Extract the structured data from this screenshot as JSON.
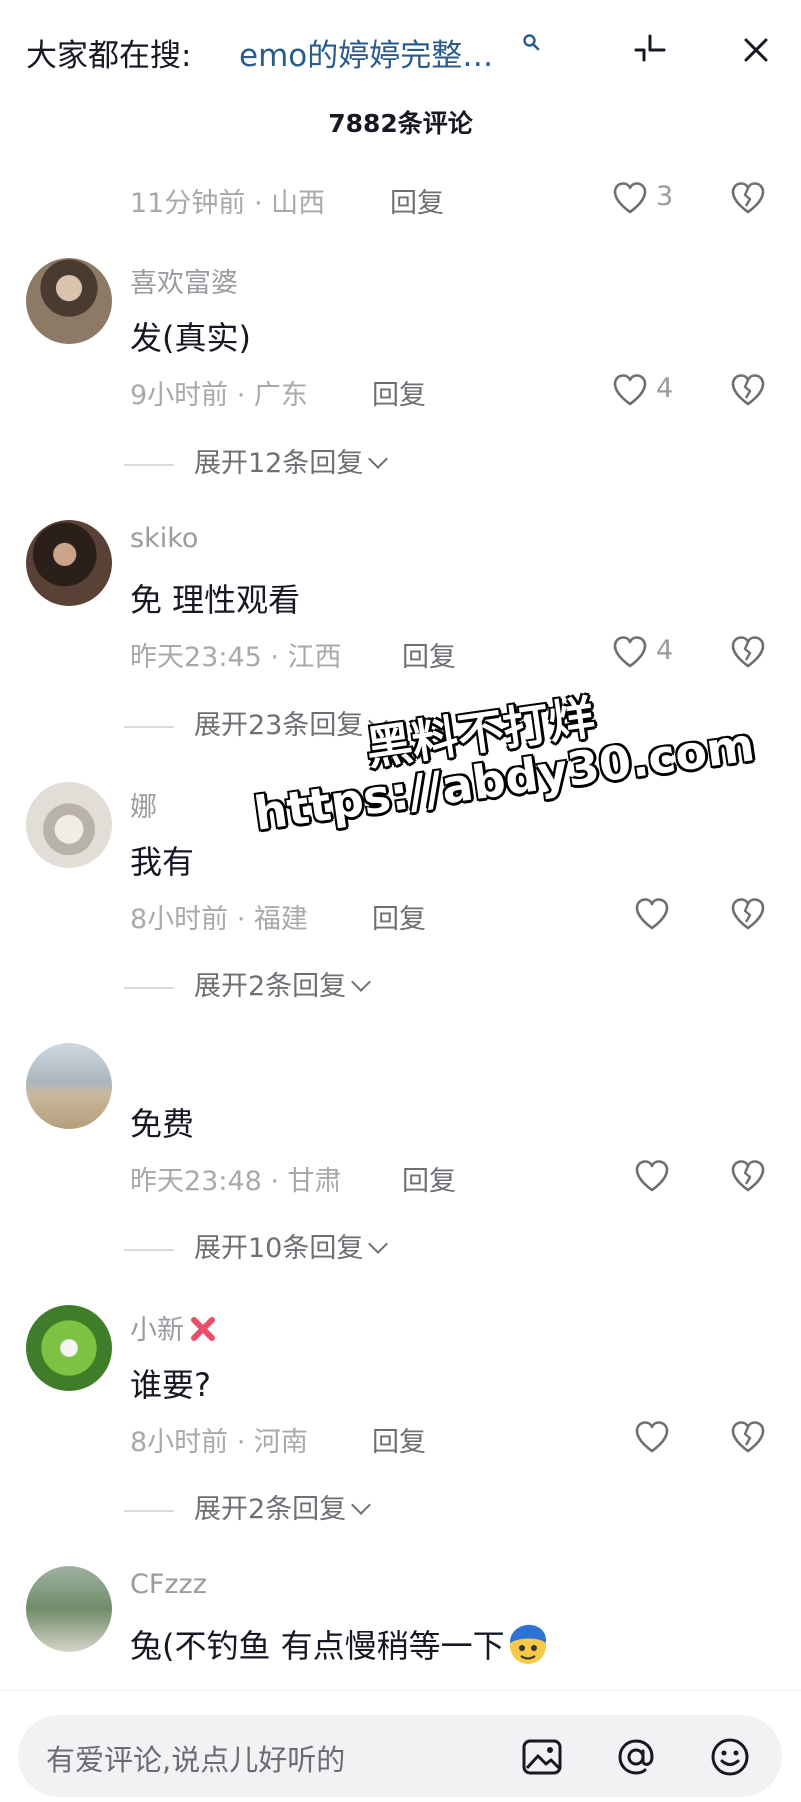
{
  "header": {
    "search_prefix": "大家都在搜:",
    "search_query": "emo的婷婷完整…",
    "search_icon": "search-icon",
    "collapse_icon": "collapse-icon",
    "close_icon": "close-icon",
    "comment_count": "7882条评论"
  },
  "comments": [
    {
      "meta": "11分钟前 · 山西",
      "reply": "回复",
      "likes": "3"
    },
    {
      "username": "喜欢富婆",
      "text": "发(真实)",
      "meta": "9小时前 · 广东",
      "reply": "回复",
      "likes": "4",
      "expand": "展开12条回复"
    },
    {
      "username": "skiko",
      "text": "免 理性观看",
      "meta": "昨天23:45 · 江西",
      "reply": "回复",
      "likes": "4",
      "expand": "展开23条回复"
    },
    {
      "username": "娜",
      "text": "我有",
      "meta": "8小时前 · 福建",
      "reply": "回复",
      "likes": "",
      "expand": "展开2条回复"
    },
    {
      "username": "",
      "text": "免费",
      "meta": "昨天23:48 · 甘肃",
      "reply": "回复",
      "likes": "",
      "expand": "展开10条回复"
    },
    {
      "username": "小新",
      "text": "谁要?",
      "meta": "8小时前 · 河南",
      "reply": "回复",
      "likes": "",
      "expand": "展开2条回复"
    },
    {
      "username": "CFzzz",
      "text": "兔(不钓鱼 有点慢稍等一下",
      "meta": "",
      "reply": "",
      "likes": ""
    }
  ],
  "watermark": {
    "line1": "黑料不打烊",
    "line2": "https://abdy30.com"
  },
  "composer": {
    "placeholder": "有爱评论,说点儿好听的",
    "icons": [
      "image-icon",
      "at-icon",
      "emoji-icon"
    ]
  },
  "colors": {
    "query_link": "#2b5b8c",
    "muted_text": "#9a9ba0",
    "primary_text": "#161823",
    "name_badge": "#e8506a"
  }
}
